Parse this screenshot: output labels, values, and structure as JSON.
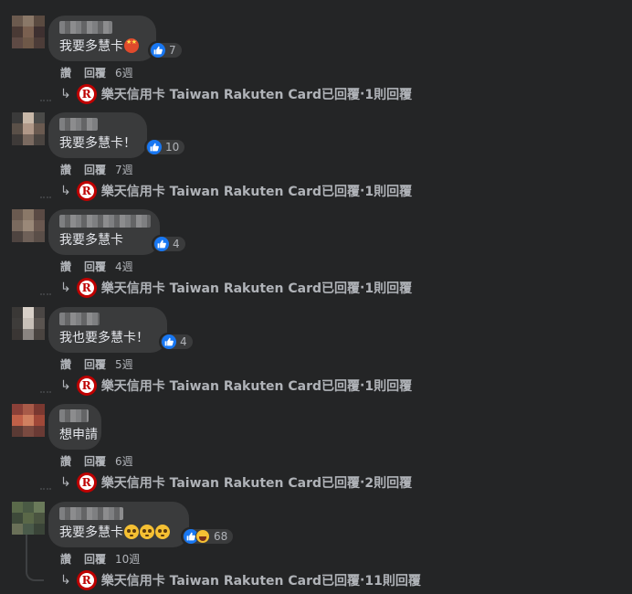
{
  "page_name": "Taiwan Rakuten Card",
  "reply_text": "已回覆",
  "action_like": "讚",
  "action_reply": "回覆",
  "reply_arrow": "↳",
  "logo_letter": "R",
  "comments": [
    {
      "text": "我要多慧卡",
      "emojis": [
        "star-struck"
      ],
      "reaction_count": "7",
      "reactions": [
        "like"
      ],
      "time": "6週",
      "replies": "1則回覆",
      "avatar_colors": [
        "#6b5a4e",
        "#8a7868",
        "#5a4a40",
        "#4a3a35",
        "#7a6050",
        "#3e3030",
        "#5e4a44",
        "#6e5848",
        "#4c3c38"
      ]
    },
    {
      "text": "我要多慧卡！",
      "emojis": [],
      "reaction_count": "10",
      "reactions": [
        "like"
      ],
      "time": "7週",
      "replies": "1則回覆",
      "avatar_colors": [
        "#3a3a3a",
        "#c8b8a8",
        "#4a4a48",
        "#5a5048",
        "#b09888",
        "#6a5a50",
        "#3e3a38",
        "#7a6a60",
        "#4a4440"
      ]
    },
    {
      "text": "我要多慧卡",
      "emojis": [],
      "reaction_count": "4",
      "reactions": [
        "like"
      ],
      "time": "4週",
      "replies": "1則回覆",
      "avatar_colors": [
        "#6a5a50",
        "#8a7868",
        "#5a4a44",
        "#7a6a5e",
        "#9a8878",
        "#6a5850",
        "#4e4440",
        "#6e6058",
        "#5a4e48"
      ]
    },
    {
      "text": "我也要多慧卡！",
      "emojis": [],
      "reaction_count": "4",
      "reactions": [
        "like"
      ],
      "time": "5週",
      "replies": "1則回覆",
      "avatar_colors": [
        "#3a3836",
        "#d8d0c8",
        "#4a4644",
        "#3e3c3a",
        "#c8c0b8",
        "#5a5450",
        "#3a3634",
        "#8a8480",
        "#4a4440"
      ]
    },
    {
      "text": "想申請",
      "emojis": [],
      "reaction_count": "",
      "reactions": [],
      "time": "6週",
      "replies": "2則回覆",
      "avatar_colors": [
        "#8a4038",
        "#a85a48",
        "#7a3830",
        "#c06048",
        "#d08060",
        "#a04838",
        "#5a3a34",
        "#7a4a40",
        "#6a3a34"
      ]
    },
    {
      "text": "我要多慧卡",
      "emojis": [
        "pleading",
        "pleading",
        "pleading"
      ],
      "reaction_count": "68",
      "reactions": [
        "like",
        "haha"
      ],
      "time": "10週",
      "replies": "11則回覆",
      "avatar_colors": [
        "#5a6a4a",
        "#4a5a44",
        "#6a7a5a",
        "#3e4a3a",
        "#5a6848",
        "#4a5440",
        "#6a7058",
        "#4a5a4a",
        "#3a4438"
      ]
    }
  ]
}
